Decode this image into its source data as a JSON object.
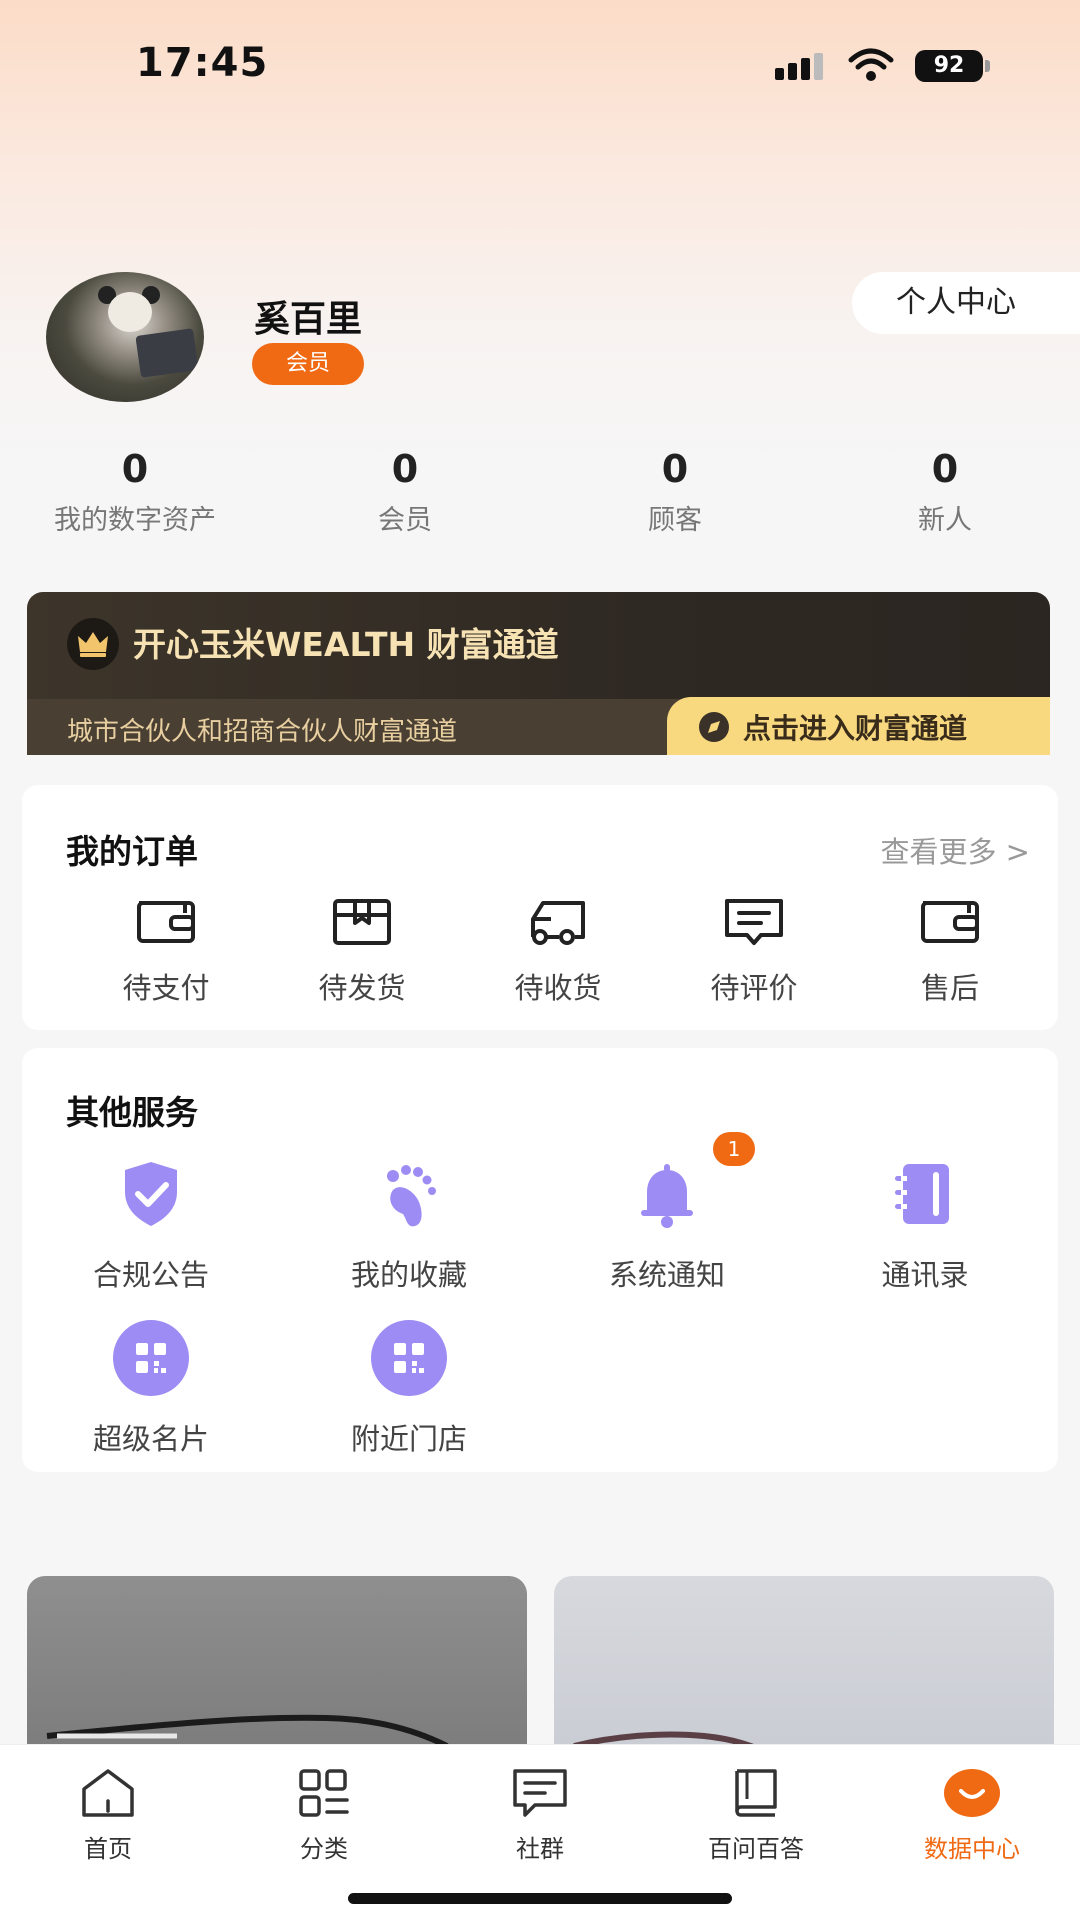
{
  "status_bar": {
    "time": "17:45",
    "battery": "92"
  },
  "profile": {
    "name": "奚百里",
    "member_badge": "会员",
    "personal_center": "个人中心"
  },
  "stats": [
    {
      "value": "0",
      "label": "我的数字资产"
    },
    {
      "value": "0",
      "label": "会员"
    },
    {
      "value": "0",
      "label": "顾客"
    },
    {
      "value": "0",
      "label": "新人"
    }
  ],
  "wealth": {
    "title": "开心玉米WEALTH 财富通道",
    "subtitle": "城市合伙人和招商合伙人财富通道",
    "enter_label": "点击进入财富通道"
  },
  "orders": {
    "title": "我的订单",
    "more": "查看更多 >",
    "items": [
      {
        "label": "待支付",
        "icon": "wallet-icon"
      },
      {
        "label": "待发货",
        "icon": "package-icon"
      },
      {
        "label": "待收货",
        "icon": "truck-icon"
      },
      {
        "label": "待评价",
        "icon": "comment-icon"
      },
      {
        "label": "售后",
        "icon": "wallet-icon"
      }
    ]
  },
  "services": {
    "title": "其他服务",
    "items": [
      {
        "label": "合规公告",
        "icon": "shield-check-icon"
      },
      {
        "label": "我的收藏",
        "icon": "footprint-icon"
      },
      {
        "label": "系统通知",
        "icon": "bell-icon",
        "badge": "1"
      },
      {
        "label": "通讯录",
        "icon": "contacts-book-icon"
      },
      {
        "label": "超级名片",
        "icon": "qr-code-icon"
      },
      {
        "label": "附近门店",
        "icon": "qr-code-icon"
      }
    ]
  },
  "tabbar": [
    {
      "label": "首页",
      "icon": "home-icon"
    },
    {
      "label": "分类",
      "icon": "grid-icon"
    },
    {
      "label": "社群",
      "icon": "chat-icon"
    },
    {
      "label": "百问百答",
      "icon": "book-icon"
    },
    {
      "label": "数据中心",
      "icon": "smile-icon",
      "active": true
    }
  ],
  "colors": {
    "accent": "#f06a14",
    "service_purple": "#9d8cf3",
    "gold": "#f8d97f"
  }
}
